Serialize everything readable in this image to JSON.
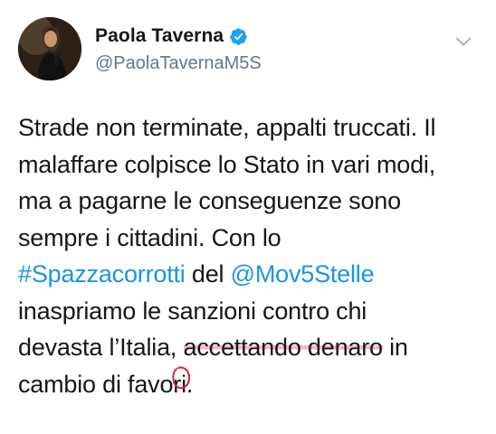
{
  "author": {
    "name": "Paola Taverna",
    "handle": "@PaolaTavernaM5S",
    "verified_icon": "verified-badge-icon",
    "avatar_icon": "profile-photo"
  },
  "menu_icon": "chevron-down-icon",
  "tweet": {
    "line1": "Strade non terminate, appalti truccati. Il",
    "line2": "malaffare colpisce lo Stato in vari modi,",
    "line3": "ma a pagarne le conseguenze sono",
    "line4": "sempre i cittadini. Con lo",
    "hashtag": "#Spazzacorrotti",
    "line5_mid": " del ",
    "mention": "@Mov5Stelle",
    "line6": "inaspriamo le sanzioni contro chi",
    "line7_pre": "devasta l’Italia",
    "line7_comma": ",",
    "line7_space": " ",
    "highlighted": "accettando denaro",
    "line7_post": " in",
    "line8": "cambio di favori."
  },
  "colors": {
    "link": "#1b95e0",
    "verified": "#1da1f2",
    "handle": "#657786",
    "highlight": "#f4a0aa",
    "circle": "#d9232e"
  }
}
